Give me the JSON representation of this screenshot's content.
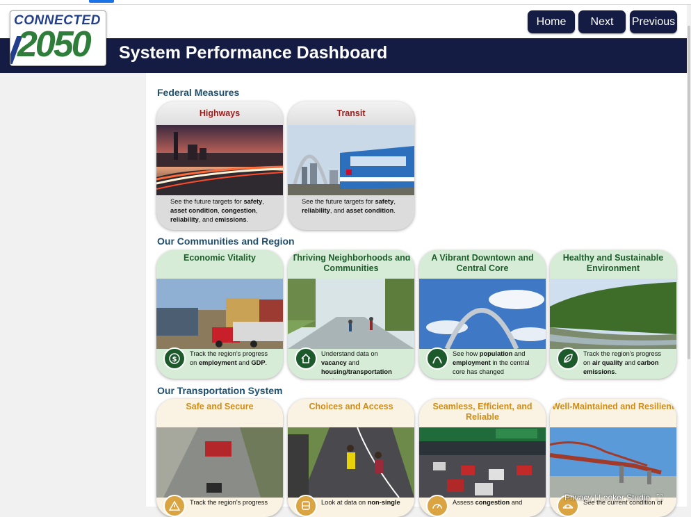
{
  "logo": {
    "line1": "CONNECTED",
    "line2": "2050"
  },
  "header": {
    "title": "System Performance Dashboard"
  },
  "nav": {
    "home": "Home",
    "next": "Next",
    "previous": "Previous"
  },
  "sections": {
    "federal": "Federal Measures",
    "communities": "Our Communities and Region",
    "transportation": "Our Transportation System"
  },
  "federal_cards": [
    {
      "title": "Highways",
      "desc_pre": "See the future targets for ",
      "desc_b1": "safety",
      "desc_mid1": ", ",
      "desc_b2": "asset condition",
      "desc_mid2": ", ",
      "desc_b3": "congestion",
      "desc_mid3": ", ",
      "desc_b4": "reliability",
      "desc_mid4": ", and ",
      "desc_b5": "emissions",
      "desc_end": "."
    },
    {
      "title": "Transit",
      "desc_pre": "See the future targets for ",
      "desc_b1": "safety",
      "desc_mid1": ", ",
      "desc_b2": "reliability",
      "desc_mid2": ", and ",
      "desc_b3": "asset condition",
      "desc_end": "."
    }
  ],
  "community_cards": [
    {
      "title": "Economic Vitality",
      "desc_pre": "Track the region's progress on ",
      "desc_b1": "employment",
      "desc_mid1": " and ",
      "desc_b2": "GDP",
      "desc_end": "."
    },
    {
      "title": "Thriving Neighborhoods and Communities",
      "desc_pre": "Understand data on ",
      "desc_b1": "vacancy",
      "desc_mid1": " and ",
      "desc_b2": "housing/transportation costs",
      "desc_end": "."
    },
    {
      "title": "A Vibrant Downtown and Central Core",
      "desc_pre": "See how ",
      "desc_b1": "population",
      "desc_mid1": " and ",
      "desc_b2": "employment",
      "desc_end": " in the central core has changed"
    },
    {
      "title": "Healthy and Sustainable Environment",
      "desc_pre": "Track the region's progress on ",
      "desc_b1": "air quality",
      "desc_mid1": " and ",
      "desc_b2": "carbon emissions",
      "desc_end": "."
    }
  ],
  "transport_cards": [
    {
      "title": "Safe and Secure",
      "desc": "Track the region's progress"
    },
    {
      "title": "Choices and Access",
      "desc_pre": "Look at data on ",
      "desc_b1": "non-single"
    },
    {
      "title": "Seamless, Efficient, and Reliable",
      "desc_pre": "Assess ",
      "desc_b1": "congestion",
      "desc_end": " and"
    },
    {
      "title": "Well-Maintained and Resilient",
      "desc": "See the current condition of"
    }
  ],
  "footer": {
    "privacy": "Privacy",
    "sep": "|",
    "brand": "Looker Studio"
  },
  "colors": {
    "navy": "#141c44",
    "federal_title": "#9c1b1b",
    "community_title": "#1d5d2b",
    "transport_title": "#cf8c16",
    "section": "#1e4f6e"
  }
}
